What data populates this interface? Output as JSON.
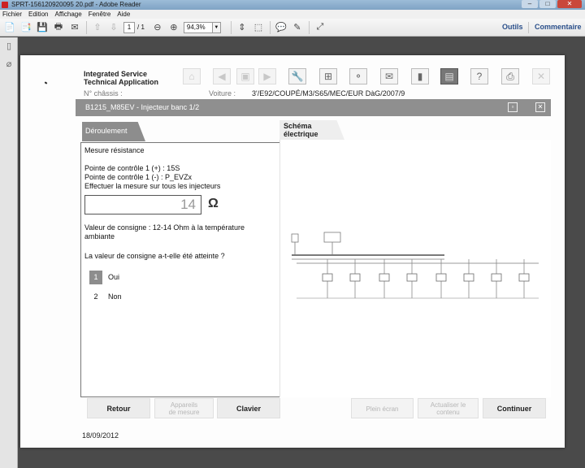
{
  "window": {
    "title": "SPRT-156120920095 20.pdf - Adobe Reader",
    "controls": {
      "minimize": "–",
      "maximize": "□",
      "close": "✕"
    }
  },
  "menu": [
    "Fichier",
    "Edition",
    "Affichage",
    "Fenêtre",
    "Aide"
  ],
  "toolbar": {
    "page_current": "1",
    "page_total": "/ 1",
    "zoom": "94,3%",
    "tools_label": "Outils",
    "comment_label": "Commentaire"
  },
  "ista": {
    "app_title_line1": "Integrated Service",
    "app_title_line2": "Technical Application",
    "chassis_label": "N° châssis :",
    "voiture_label": "Voiture :",
    "voiture_value": "3'/E92/COUPÉ/M3/S65/MEC/EUR DàG/2007/9",
    "window_title": "B1215_M85EV - Injecteur banc 1/2",
    "tabs": {
      "deroulement": "Déroulement",
      "schema_line1": "Schéma",
      "schema_line2": "électrique"
    },
    "procedure": {
      "heading": "Mesure résistance",
      "line1": "Pointe de contrôle 1 (+) : 15S",
      "line2": "Pointe de contrôle 1 (-) : P_EVZx",
      "line3": "Effectuer la mesure sur tous les injecteurs",
      "measure_value": "14",
      "unit": "Ω",
      "setpoint_line1": "Valeur de consigne : 12-14 Ohm à la température",
      "setpoint_line2": "ambiante",
      "question": "La valeur de consigne a-t-elle été atteinte ?",
      "options": [
        {
          "num": "1",
          "label": "Oui",
          "selected": true
        },
        {
          "num": "2",
          "label": "Non",
          "selected": false
        }
      ]
    },
    "buttons": {
      "retour": "Retour",
      "appareils_line1": "Appareils",
      "appareils_line2": "de mesure",
      "clavier": "Clavier",
      "plein_ecran": "Plein écran",
      "actualiser_line1": "Actualiser le",
      "actualiser_line2": "contenu",
      "continuer": "Continuer"
    },
    "date": "18/09/2012"
  },
  "colors": {
    "title_bar": "#8fb2d2",
    "header_bar": "#8f8f8f",
    "selected_option": "#8d8d8d",
    "link": "#2a4f8a"
  }
}
